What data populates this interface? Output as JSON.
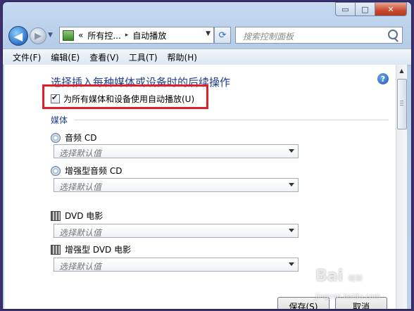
{
  "window": {
    "caption": {
      "minimize": "▭",
      "maximize": "□",
      "close": "✕"
    }
  },
  "nav": {
    "back_icon": "back-arrow-icon",
    "forward_icon": "forward-arrow-icon",
    "breadcrumb_prefix": "«",
    "breadcrumb_1": "所有控...",
    "breadcrumb_sep": "▸",
    "breadcrumb_2": "自动播放",
    "refresh_icon": "refresh-icon",
    "search_placeholder": "搜索控制面板"
  },
  "menubar": {
    "items": [
      "文件(F)",
      "编辑(E)",
      "查看(V)",
      "工具(T)",
      "帮助(H)"
    ]
  },
  "content": {
    "heading": "选择插入每种媒体或设备时的后续操作",
    "checkbox_label": "为所有媒体和设备使用自动播放(U)",
    "checkbox_checked": true,
    "section_title": "媒体",
    "media": [
      {
        "label": "音频 CD",
        "icon": "audio-cd-icon",
        "selected": "选择默认值"
      },
      {
        "label": "增强型音频 CD",
        "icon": "enhanced-audio-cd-icon",
        "selected": "选择默认值"
      },
      {
        "label": "DVD 电影",
        "icon": "dvd-movie-icon",
        "selected": "选择默认值"
      },
      {
        "label": "增强型 DVD 电影",
        "icon": "enhanced-dvd-movie-icon",
        "selected": "选择默认值"
      }
    ],
    "save_button": "保存(S)",
    "cancel_button": "取消"
  },
  "highlight_color": "#e11e2b",
  "watermark": {
    "text": "Bai",
    "sub": "经验",
    "url": "jingyan.baidu.com"
  }
}
